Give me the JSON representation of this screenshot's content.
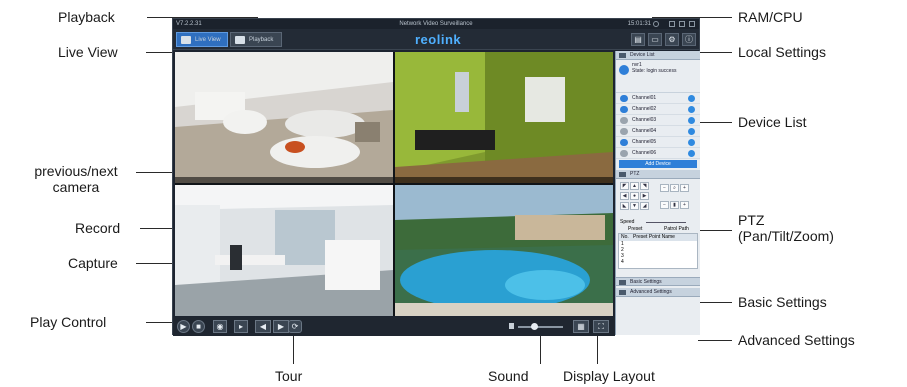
{
  "labels": {
    "playback": "Playback",
    "live_view": "Live View",
    "prev_next": "previous/next",
    "camera": "camera",
    "record": "Record",
    "capture": "Capture",
    "play_control": "Play Control",
    "tour": "Tour",
    "sound": "Sound",
    "display_layout": "Display Layout",
    "ram_cpu": "RAM/CPU",
    "local_settings": "Local Settings",
    "device_list": "Device List",
    "ptz": "PTZ",
    "ptz_sub": "(Pan/Tilt/Zoom)",
    "basic_settings": "Basic Settings",
    "advanced_settings": "Advanced Settings"
  },
  "app": {
    "version": "V7.2.2.31",
    "title": "Network Video Surveillance",
    "time": "15:01:31",
    "logo": "reolink",
    "tabs": {
      "live": "Live View",
      "playback": "Playback"
    },
    "sidebar": {
      "device_list_title": "Device List",
      "device_name": "nvr1",
      "device_status": "State: login success",
      "channels": [
        "Channel01",
        "Channel02",
        "Channel03",
        "Channel04",
        "Channel05",
        "Channel06"
      ],
      "add_device": "Add Device",
      "ptz_title": "PTZ",
      "speed_label": "Speed",
      "preset_label": "Preset",
      "patrol_label": "Patrol Path",
      "table_header_no": "No.",
      "table_header_name": "Preset Point Name",
      "table_rows": [
        "1",
        "2",
        "3",
        "4"
      ],
      "basic_settings": "Basic Settings",
      "advanced_settings": "Advanced Settings"
    }
  },
  "colors": {
    "accent": "#2f6fbf",
    "logo": "#4fb0ff",
    "app_bg": "#1d2430"
  }
}
